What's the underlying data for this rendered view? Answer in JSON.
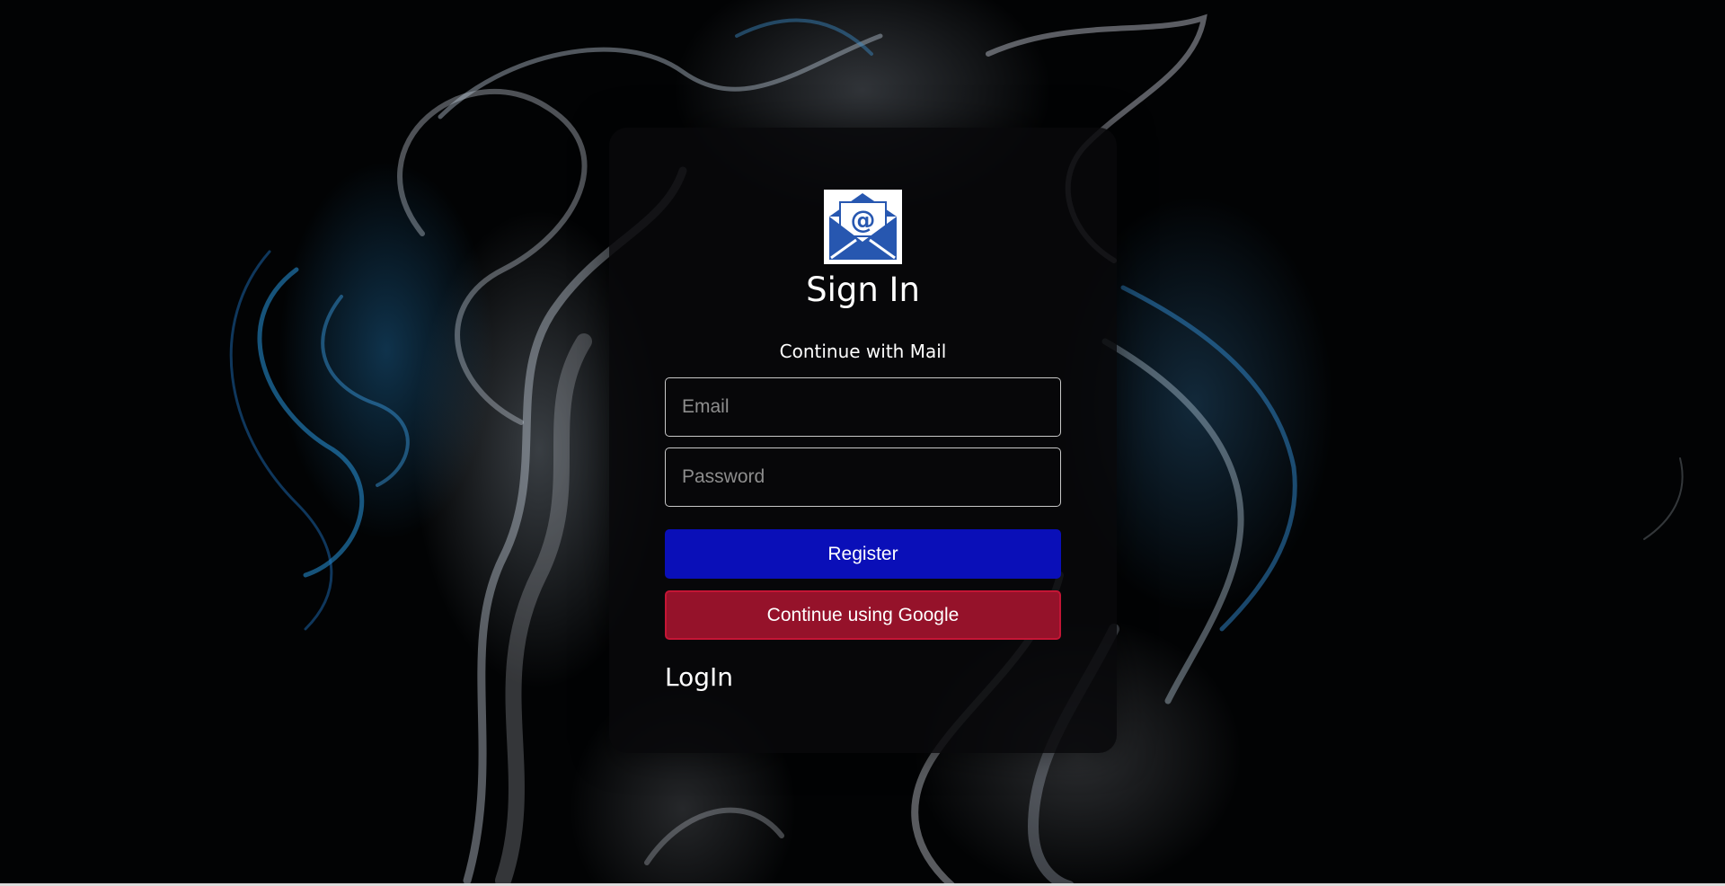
{
  "signin": {
    "title": "Sign In",
    "subtitle": "Continue with Mail",
    "email_placeholder": "Email",
    "email_value": "",
    "password_placeholder": "Password",
    "password_value": "",
    "register_label": "Register",
    "google_label": "Continue using Google",
    "login_label": "LogIn"
  },
  "logo": {
    "symbol": "@",
    "icon": "envelope-at-icon"
  },
  "colors": {
    "register_button": "#0a0fb8",
    "google_button": "#95122a",
    "google_border": "#c41535",
    "logo_blue": "#2757b0"
  }
}
